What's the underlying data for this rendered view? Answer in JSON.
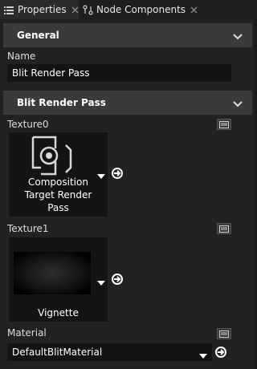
{
  "tabs": [
    {
      "label": "Properties",
      "active": true,
      "icon": "list-icon"
    },
    {
      "label": "Node Components",
      "active": false,
      "icon": "node-components-icon"
    }
  ],
  "sections": {
    "general": {
      "title": "General"
    },
    "blit": {
      "title": "Blit Render Pass"
    }
  },
  "properties": {
    "name": {
      "label": "Name",
      "value": "Blit Render Pass"
    },
    "texture0": {
      "label": "Texture0",
      "caption_line1": "Composition",
      "caption_line2": "Target Render",
      "caption_line3": "Pass"
    },
    "texture1": {
      "label": "Texture1",
      "caption": "Vignette"
    },
    "material": {
      "label": "Material",
      "value": "DefaultBlitMaterial"
    }
  },
  "colors": {
    "panel_bg": "#222222",
    "header_bg": "#3a3a3a",
    "field_bg": "#141414",
    "text": "#e6e6e6"
  }
}
